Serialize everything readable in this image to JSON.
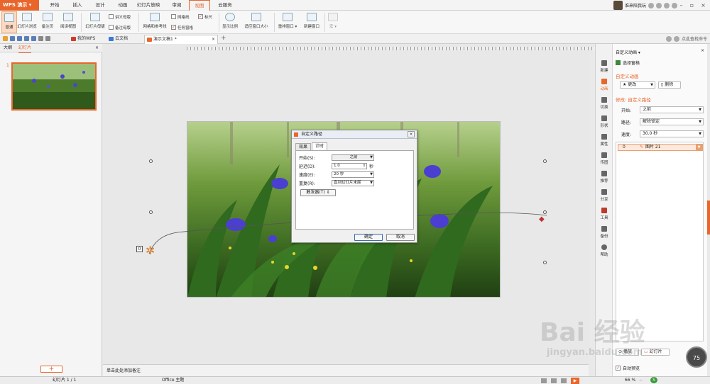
{
  "app": {
    "name": "WPS 演示"
  },
  "menu": {
    "tabs": [
      {
        "label": "开始"
      },
      {
        "label": "插入"
      },
      {
        "label": "设计"
      },
      {
        "label": "动画"
      },
      {
        "label": "幻灯片放映"
      },
      {
        "label": "审阅"
      },
      {
        "label": "视图"
      },
      {
        "label": "云服务"
      }
    ],
    "active": "视图",
    "user": "谁来陪我玩"
  },
  "ribbon": {
    "normal": "普通",
    "slide_browse": "幻灯片浏览",
    "notes_page": "备注页",
    "reading_view": "阅读视图",
    "slide_master": "幻灯片母版",
    "handout_master": "讲义母版",
    "notes_master": "备注母版",
    "grid_guides": "网格和参考线",
    "gridlines": "网格线",
    "ruler": "标尺",
    "taskpane": "任务窗格",
    "zoom": "显示比例",
    "fit_window": "适应窗口大小",
    "arrange": "重排窗口",
    "new_window": "新建窗口",
    "macro": "宏"
  },
  "quickbar": {
    "tabs": [
      {
        "label": "我的WPS"
      },
      {
        "label": "云文档"
      },
      {
        "label": "演示文稿1 *"
      }
    ],
    "search_placeholder": "点此查找命令"
  },
  "leftpanel": {
    "tab_outline": "大纲",
    "tab_slides": "幻灯片",
    "slide_number": "1",
    "add_button": "+"
  },
  "canvas": {
    "anchor_label": "0",
    "notes_placeholder": "单击此处添加备注"
  },
  "dialog": {
    "title": "自定义路径",
    "tabs": [
      {
        "label": "效果"
      },
      {
        "label": "计时"
      }
    ],
    "active_tab": "计时",
    "start_label": "开始(S):",
    "start_value": "之前",
    "delay_label": "延迟(D):",
    "delay_value": "1.0",
    "delay_unit": "秒",
    "speed_label": "速度(E):",
    "speed_value": "20 秒",
    "repeat_label": "重复(R):",
    "repeat_value": "直到幻灯片末尾",
    "trigger_button": "触发器(T) ⇕",
    "ok": "确定",
    "cancel": "取消"
  },
  "rightstrip": {
    "items": [
      {
        "label": "新建",
        "icon": "new-icon"
      },
      {
        "label": "动画",
        "icon": "animation-icon"
      },
      {
        "label": "切换",
        "icon": "transition-icon"
      },
      {
        "label": "形状",
        "icon": "shape-icon"
      },
      {
        "label": "属性",
        "icon": "property-icon"
      },
      {
        "label": "传图",
        "icon": "upload-image-icon"
      },
      {
        "label": "推荐",
        "icon": "recommend-icon"
      },
      {
        "label": "分享",
        "icon": "share-icon"
      },
      {
        "label": "工具",
        "icon": "tool-icon"
      },
      {
        "label": "备份",
        "icon": "backup-icon"
      },
      {
        "label": "帮助",
        "icon": "help-icon"
      }
    ]
  },
  "taskpane": {
    "title": "自定义动画 ▾",
    "select_pane": "选择窗格",
    "section_title": "自定义动画",
    "change_button": "更改",
    "delete_button": "删除",
    "modify_label": "修改: 自定义路径",
    "start_label": "开始:",
    "start_value": "之前",
    "path_label": "路径:",
    "path_value": "解除锁定",
    "speed_label": "速度:",
    "speed_value": "30.0 秒",
    "anim_item_number": "0",
    "anim_item_name": "图片 21",
    "play_button": "播放",
    "slideshow_button": "幻灯片",
    "autopreview_label": "自动预览"
  },
  "statusbar": {
    "slide_info": "幻灯片 1 / 1",
    "theme": "Office 主题",
    "zoom": "66 %"
  },
  "overlay": {
    "speed_percent": "75",
    "watermark_main": "Bai 经验",
    "watermark_url": "jingyan.baidu.com"
  },
  "colors": {
    "accent": "#e8662c",
    "dialog_title_bg": "#e9eef5"
  }
}
